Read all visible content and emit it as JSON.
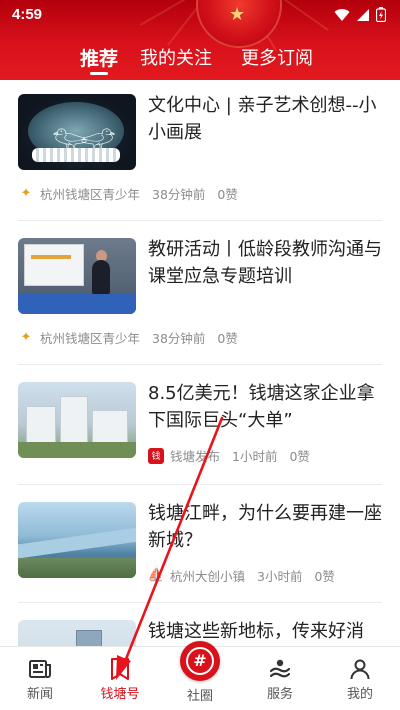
{
  "status_bar": {
    "time": "4:59"
  },
  "tabs": [
    {
      "label": "推荐",
      "active": true
    },
    {
      "label": "我的关注",
      "active": false
    },
    {
      "label": "更多订阅",
      "active": false
    }
  ],
  "articles": [
    {
      "title": "文化中心 | 亲子艺术创想--小小画展",
      "source": "杭州钱塘区青少年",
      "time": "38分钟前",
      "likes": "0赞"
    },
    {
      "title": "教研活动丨低龄段教师沟通与课堂应急专题培训",
      "source": "杭州钱塘区青少年",
      "time": "38分钟前",
      "likes": "0赞"
    },
    {
      "title": "8.5亿美元！钱塘这家企业拿下国际巨头“大单”",
      "source": "钱塘发布",
      "time": "1小时前",
      "likes": "0赞"
    },
    {
      "title": "钱塘江畔，为什么要再建一座新城？",
      "source": "杭州大创小镇",
      "time": "3小时前",
      "likes": "0赞"
    },
    {
      "title": "钱塘这些新地标，传来好消",
      "source": "",
      "time": "",
      "likes": ""
    }
  ],
  "bottom_nav": [
    {
      "label": "新闻",
      "icon": "news-icon",
      "active": false
    },
    {
      "label": "钱塘号",
      "icon": "bookmark-plus-icon",
      "active": true
    },
    {
      "label": "社圈",
      "icon": "hashtag-icon",
      "active": false
    },
    {
      "label": "服务",
      "icon": "service-icon",
      "active": false
    },
    {
      "label": "我的",
      "icon": "person-icon",
      "active": false
    }
  ],
  "colors": {
    "brand_red": "#d8111b",
    "text_dark": "#222222",
    "text_meta": "#8c8c8c"
  }
}
